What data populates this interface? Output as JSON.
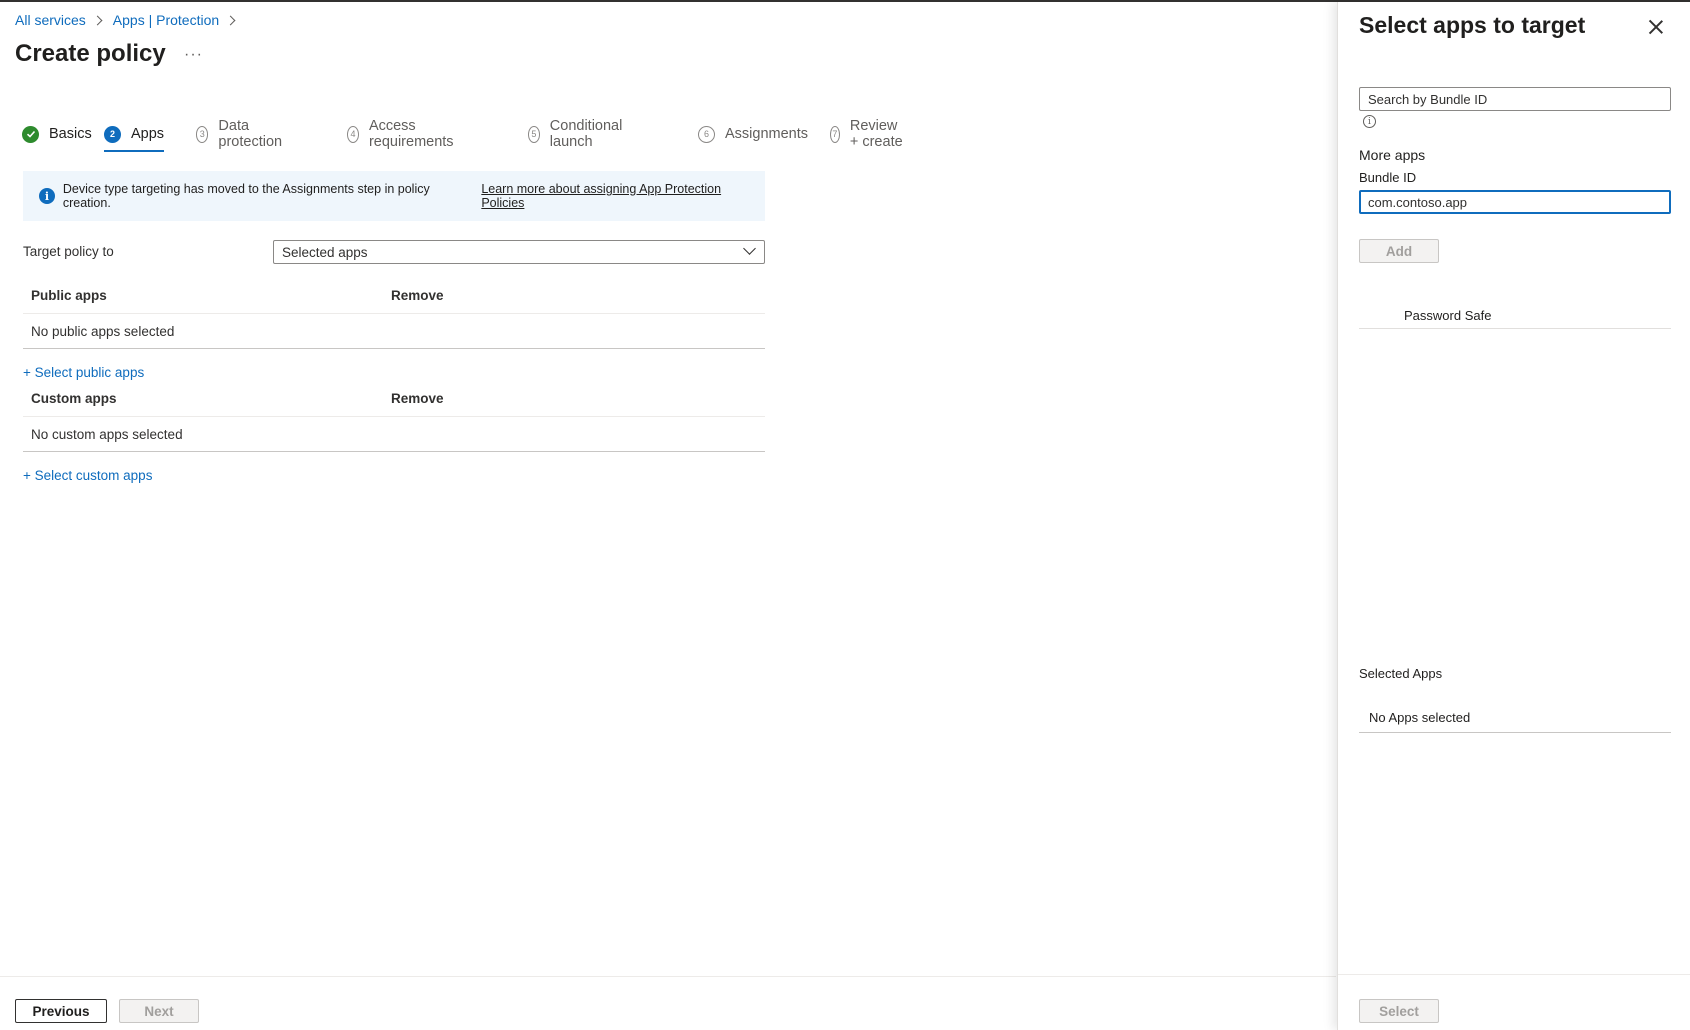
{
  "breadcrumb": {
    "items": [
      "All services",
      "Apps | Protection"
    ]
  },
  "page": {
    "title": "Create policy",
    "more": "···"
  },
  "steps": [
    {
      "num": "",
      "label": "Basics",
      "state": "done"
    },
    {
      "num": "2",
      "label": "Apps",
      "state": "active"
    },
    {
      "num": "3",
      "label": "Data protection",
      "state": "todo"
    },
    {
      "num": "4",
      "label": "Access requirements",
      "state": "todo"
    },
    {
      "num": "5",
      "label": "Conditional launch",
      "state": "todo"
    },
    {
      "num": "6",
      "label": "Assignments",
      "state": "todo"
    },
    {
      "num": "7",
      "label": "Review + create",
      "state": "todo"
    }
  ],
  "banner": {
    "text": "Device type targeting has moved to the Assignments step in policy creation.",
    "link": "Learn more about assigning App Protection Policies"
  },
  "target": {
    "label": "Target policy to",
    "value": "Selected apps"
  },
  "public_apps": {
    "col1": "Public apps",
    "col2": "Remove",
    "empty": "No public apps selected",
    "add_link": "+ Select public apps"
  },
  "custom_apps": {
    "col1": "Custom apps",
    "col2": "Remove",
    "empty": "No custom apps selected",
    "add_link": "+ Select custom apps"
  },
  "footer": {
    "previous": "Previous",
    "next": "Next"
  },
  "panel": {
    "title": "Select apps to target",
    "search_placeholder": "Search by Bundle ID",
    "more_apps": "More apps",
    "bundle_label": "Bundle ID",
    "bundle_value": "com.contoso.app",
    "add": "Add",
    "apps": [
      "Password Safe"
    ],
    "selected_label": "Selected Apps",
    "no_apps": "No Apps selected",
    "select": "Select"
  },
  "colors": {
    "accent": "#0f6cbd",
    "success": "#2e8b2e",
    "banner_bg": "#eff6fc"
  }
}
